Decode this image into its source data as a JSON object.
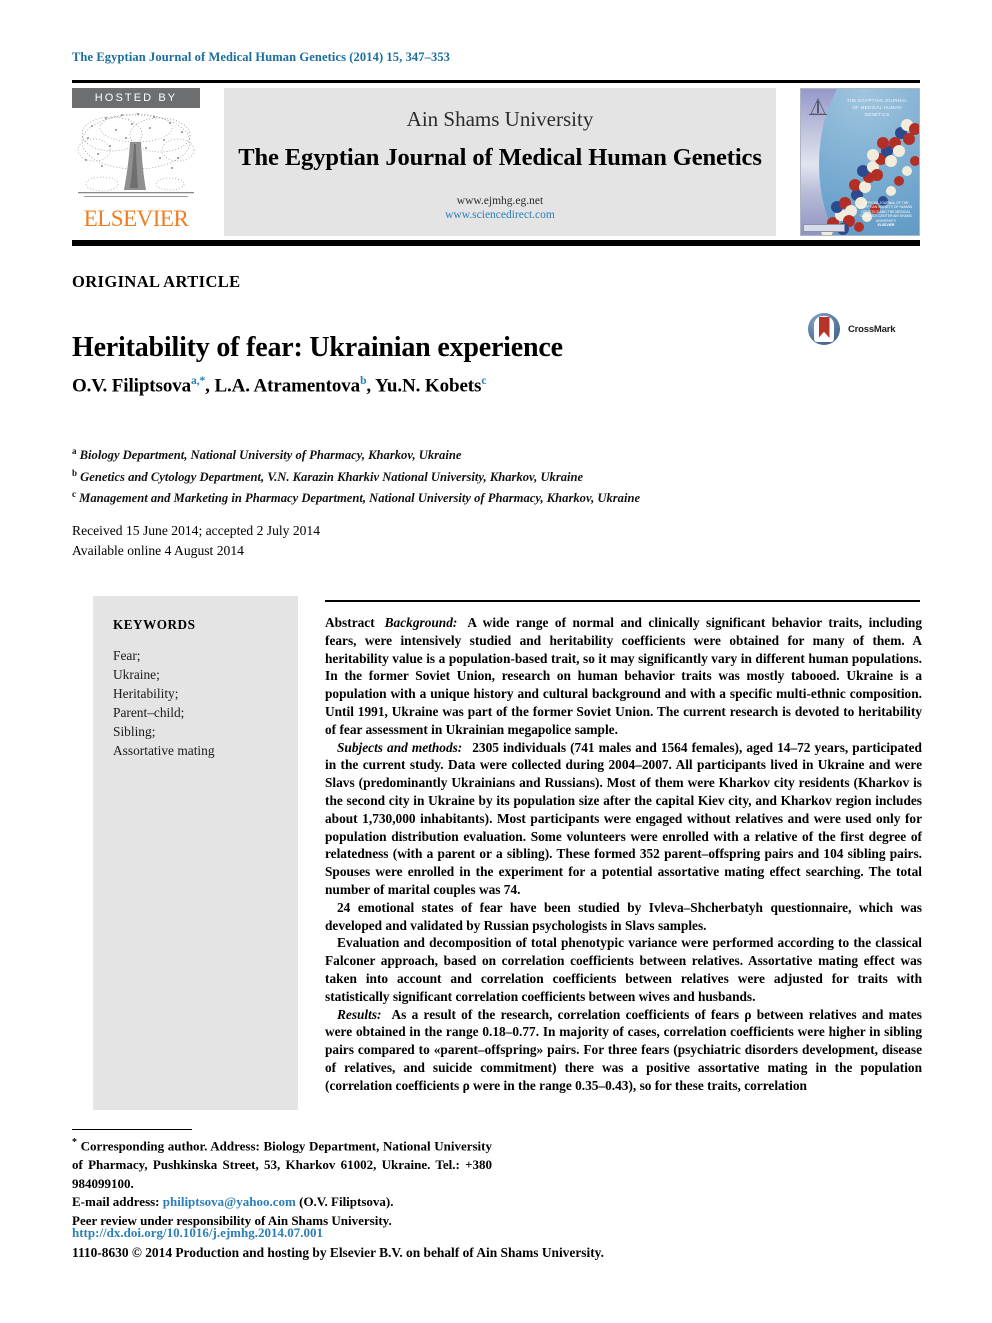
{
  "running_head": "The Egyptian Journal of Medical Human Genetics (2014) 15, 347–353",
  "header": {
    "hosted_by_label": "HOSTED BY",
    "publisher_name": "ELSEVIER",
    "university": "Ain Shams University",
    "journal_title": "The Egyptian Journal of Medical Human Genetics",
    "url_journal": "www.ejmhg.eg.net",
    "url_sciencedirect": "www.sciencedirect.com",
    "cover": {
      "title_line1": "THE EGYPTIAN JOURNAL",
      "title_line2": "OF MEDICAL HUMAN",
      "title_line3": "GENETICS",
      "footer_text": "OFFICIAL JOURNAL OF THE EGYPTIAN SOCIETY OF HUMAN GENETICS AND THE MEDICAL GENETICS CENTER AIN SHAMS UNIVERSITY",
      "footer_brand": "ELSEVIER"
    }
  },
  "article": {
    "type": "ORIGINAL ARTICLE",
    "title": "Heritability of fear: Ukrainian experience",
    "crossmark_label": "CrossMark",
    "authors": [
      {
        "name": "O.V. Filiptsova",
        "marks": "a,*"
      },
      {
        "name": "L.A. Atramentova",
        "marks": "b"
      },
      {
        "name": "Yu.N. Kobets",
        "marks": "c"
      }
    ],
    "affiliations": [
      {
        "mark": "a",
        "text": "Biology Department, National University of Pharmacy, Kharkov, Ukraine"
      },
      {
        "mark": "b",
        "text": "Genetics and Cytology Department, V.N. Karazin Kharkiv National University, Kharkov, Ukraine"
      },
      {
        "mark": "c",
        "text": "Management and Marketing in Pharmacy Department, National University of Pharmacy, Kharkov, Ukraine"
      }
    ],
    "received_line": "Received 15 June 2014; accepted 2 July 2014",
    "available_line": "Available online 4 August 2014"
  },
  "keywords": {
    "heading": "KEYWORDS",
    "items": "Fear;\nUkraine;\nHeritability;\nParent–child;\nSibling;\nAssortative mating"
  },
  "abstract": {
    "label": "Abstract",
    "background_label": "Background:",
    "background_text": "A wide range of normal and clinically significant behavior traits, including fears, were intensively studied and heritability coefficients were obtained for many of them. A heritability value is a population-based trait, so it may significantly vary in different human populations. In the former Soviet Union, research on human behavior traits was mostly tabooed. Ukraine is a population with a unique history and cultural background and with a specific multi-ethnic composition. Until 1991, Ukraine was part of the former Soviet Union. The current research is devoted to heritability of fear assessment in Ukrainian megapolice sample.",
    "subjects_label": "Subjects and methods:",
    "subjects_text": "2305 individuals (741 males and 1564 females), aged 14–72 years, participated in the current study. Data were collected during 2004–2007. All participants lived in Ukraine and were Slavs (predominantly Ukrainians and Russians). Most of them were Kharkov city residents (Kharkov is the second city in Ukraine by its population size after the capital Kiev city, and Kharkov region includes about 1,730,000 inhabitants). Most participants were engaged without relatives and were used only for population distribution evaluation. Some volunteers were enrolled with a relative of the first degree of relatedness (with a parent or a sibling). These formed 352 parent–offspring pairs and 104 sibling pairs. Spouses were enrolled in the experiment for a potential assortative mating effect searching. The total number of marital couples was 74.",
    "para3_text": "24 emotional states of fear have been studied by Ivleva–Shcherbatyh questionnaire, which was developed and validated by Russian psychologists in Slavs samples.",
    "para4_text": "Evaluation and decomposition of total phenotypic variance were performed according to the classical Falconer approach, based on correlation coefficients between relatives. Assortative mating effect was taken into account and correlation coefficients between relatives were adjusted for traits with statistically significant correlation coefficients between wives and husbands.",
    "results_label": "Results:",
    "results_text": "As a result of the research, correlation coefficients of fears ρ between relatives and mates were obtained in the range 0.18–0.77. In majority of cases, correlation coefficients were higher in sibling pairs compared to «parent–offspring» pairs. For three fears (psychiatric disorders development, disease of relatives, and suicide commitment) there was a positive assortative mating in the population (correlation coefficients ρ were in the range 0.35–0.43), so for these traits, correlation"
  },
  "footer": {
    "corresponding_marker": "*",
    "corresponding_text": "Corresponding author. Address: Biology Department, National University of Pharmacy, Pushkinska Street, 53, Kharkov 61002, Ukraine. Tel.: +380 984099100.",
    "email_label": "E-mail address:",
    "email": "philiptsova@yahoo.com",
    "email_owner": "(O.V. Filiptsova).",
    "peer_review": "Peer review under responsibility of Ain Shams University.",
    "doi": "http://dx.doi.org/10.1016/j.ejmhg.2014.07.001",
    "copyright": "1110-8630 © 2014 Production and hosting by Elsevier B.V. on behalf of Ain Shams University."
  },
  "colors": {
    "link": "#2a7fb8",
    "running_head": "#1a6ea0",
    "elsevier_orange": "#ef7d22",
    "panel_gray": "#e4e4e4",
    "hosted_gray": "#6d6e70"
  }
}
